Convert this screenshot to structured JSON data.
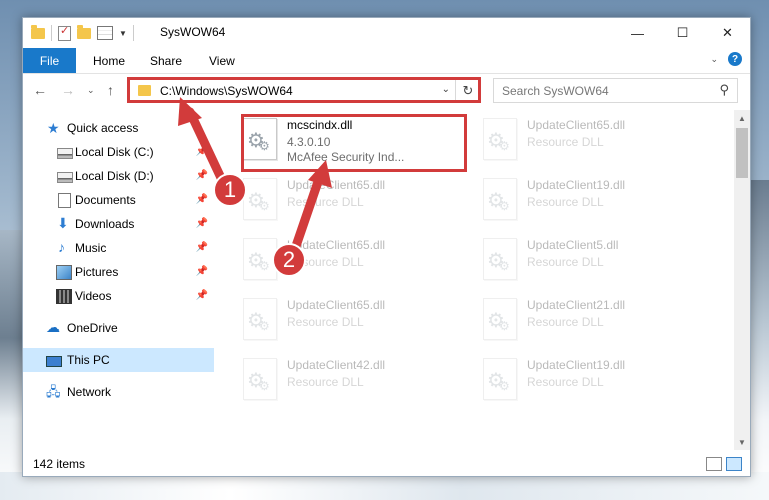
{
  "window": {
    "title": "SysWOW64",
    "buttons": {
      "minimize": "—",
      "maximize": "☐",
      "close": "✕"
    }
  },
  "ribbon": {
    "tabs": [
      {
        "label": "File"
      },
      {
        "label": "Home"
      },
      {
        "label": "Share"
      },
      {
        "label": "View"
      }
    ]
  },
  "navbar": {
    "path": "C:\\Windows\\SysWOW64",
    "search_placeholder": "Search SysWOW64"
  },
  "sidebar": {
    "items": [
      {
        "label": "Quick access",
        "icon": "star-icon"
      },
      {
        "label": "Local Disk (C:)",
        "icon": "drive-icon"
      },
      {
        "label": "Local Disk (D:)",
        "icon": "drive-icon"
      },
      {
        "label": "Documents",
        "icon": "documents-icon"
      },
      {
        "label": "Downloads",
        "icon": "download-icon"
      },
      {
        "label": "Music",
        "icon": "music-icon"
      },
      {
        "label": "Pictures",
        "icon": "pictures-icon"
      },
      {
        "label": "Videos",
        "icon": "videos-icon"
      },
      {
        "label": "OneDrive",
        "icon": "cloud-icon"
      },
      {
        "label": "This PC",
        "icon": "computer-icon"
      },
      {
        "label": "Network",
        "icon": "network-icon"
      }
    ],
    "selected": "This PC"
  },
  "files": [
    {
      "name": "mcscindx.dll",
      "line1": "4.3.0.10",
      "line2": "McAfee Security Ind..."
    },
    {
      "name": "UpdateClient65.dll",
      "line1": "Resource DLL"
    },
    {
      "name": "UpdateClient65.dll",
      "line1": "Resource DLL"
    },
    {
      "name": "UpdateClient19.dll",
      "line1": "Resource DLL"
    },
    {
      "name": "UpdateClient65.dll",
      "line1": "Resource DLL"
    },
    {
      "name": "UpdateClient5.dll",
      "line1": "Resource DLL"
    },
    {
      "name": "UpdateClient65.dll",
      "line1": "Resource DLL"
    },
    {
      "name": "UpdateClient21.dll",
      "line1": "Resource DLL"
    },
    {
      "name": "UpdateClient42.dll",
      "line1": "Resource DLL"
    },
    {
      "name": "UpdateClient19.dll",
      "line1": "Resource DLL"
    }
  ],
  "status": {
    "item_count": "142 items"
  },
  "annotations": {
    "badge1": "1",
    "badge2": "2",
    "color": "#d23b3b"
  }
}
